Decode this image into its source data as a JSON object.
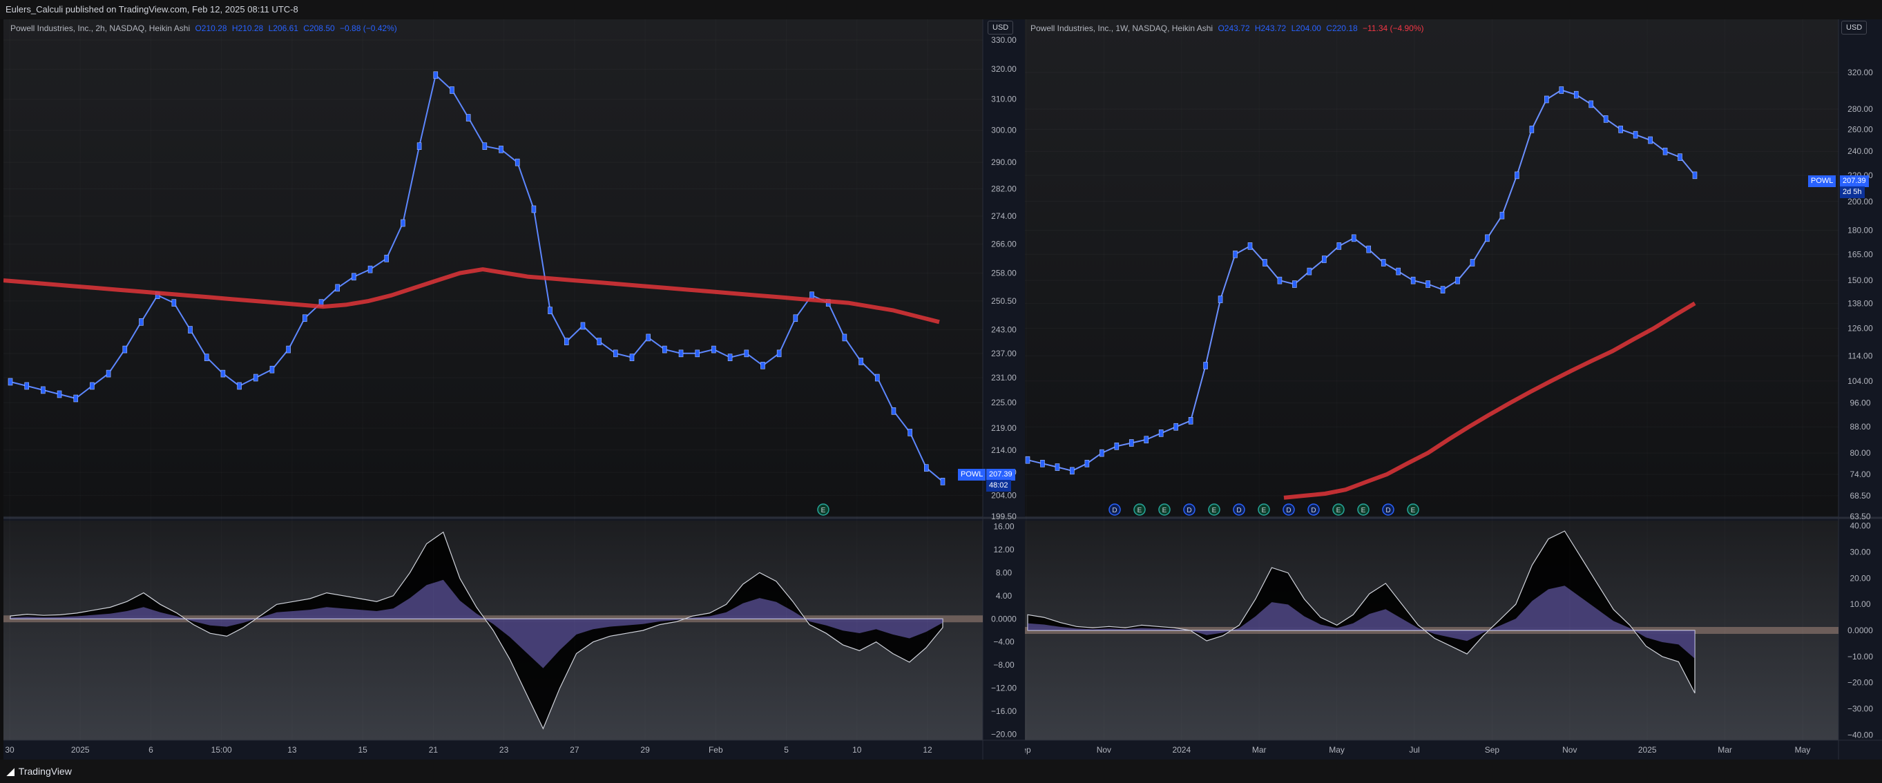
{
  "header": {
    "title": "Eulers_Calculi published on TradingView.com, Feb 12, 2025 08:11 UTC-8"
  },
  "footer": {
    "brand": "TradingView"
  },
  "charts": {
    "left": {
      "legend": {
        "name": "Powell Industries, Inc., 2h, NASDAQ, Heikin Ashi",
        "open": "O210.28",
        "high": "H210.28",
        "low": "L206.61",
        "close": "C208.50",
        "change": "−0.88 (−0.42%)"
      },
      "currency": "USD",
      "price_badge": {
        "ticker": "POWL",
        "price": "207.39",
        "countdown": "48:02"
      },
      "event_markers": [
        "E"
      ]
    },
    "right": {
      "legend": {
        "name": "Powell Industries, Inc., 1W, NASDAQ, Heikin Ashi",
        "open": "O243.72",
        "high": "H243.72",
        "low": "L204.00",
        "close": "C220.18",
        "change": "−11.34 (−4.90%)"
      },
      "currency": "USD",
      "price_badge": {
        "ticker": "POWL",
        "price": "207.39",
        "countdown": "2d 5h"
      },
      "event_markers": [
        "D",
        "E",
        "E",
        "D",
        "E",
        "D",
        "E",
        "D",
        "D",
        "E",
        "E",
        "D",
        "E"
      ]
    }
  },
  "chart_data": [
    {
      "type": "line",
      "title": "Powell Industries, Inc., 2h, NASDAQ, Heikin Ashi",
      "xticks": [
        "30",
        "2025",
        "6",
        "15:00",
        "13",
        "15",
        "21",
        "23",
        "27",
        "29",
        "Feb",
        "5",
        "10",
        "12"
      ],
      "yticks": [
        330,
        320,
        310,
        300,
        290,
        282,
        274,
        266,
        258,
        250.5,
        243,
        237,
        231,
        225,
        219,
        214,
        209,
        204,
        199.5
      ],
      "ylabels": [
        "330.00",
        "320.00",
        "310.00",
        "300.00",
        "290.00",
        "282.00",
        "274.00",
        "266.00",
        "258.00",
        "250.50",
        "243.00",
        "237.00",
        "231.00",
        "225.00",
        "219.00",
        "214.00",
        "209.00",
        "204.00",
        "199.50"
      ],
      "ylim": [
        199.5,
        330
      ],
      "scale": "log",
      "series": [
        {
          "values": [
            230,
            229,
            228,
            227,
            226,
            229,
            232,
            238,
            245,
            252,
            250,
            243,
            236,
            232,
            229,
            231,
            233,
            238,
            246,
            250,
            254,
            257,
            259,
            262,
            272,
            295,
            318,
            313,
            304,
            295,
            294,
            290,
            276,
            248,
            240,
            244,
            240,
            237,
            236,
            241,
            238,
            237,
            237,
            238,
            236,
            237,
            234,
            237,
            246,
            252,
            250,
            241,
            235,
            231,
            223,
            218,
            210,
            207
          ]
        },
        {
          "values": [
            256,
            255.5,
            255,
            254.5,
            254,
            253.5,
            253,
            252.5,
            252,
            251.5,
            251,
            250.5,
            250,
            249.5,
            249,
            249.5,
            250.5,
            252,
            254,
            256,
            258,
            259,
            258,
            257,
            256.5,
            256,
            255.5,
            255,
            254.5,
            254,
            253.5,
            253,
            252.5,
            252,
            251.5,
            251,
            250.5,
            250,
            249,
            248,
            246.5,
            245
          ]
        }
      ],
      "subplot": {
        "yticks": [
          16,
          12,
          8,
          4,
          0,
          -4,
          -8,
          -12,
          -16,
          -20
        ],
        "ylabels": [
          "16.00",
          "12.00",
          "8.00",
          "4.00",
          "0.0000",
          "−4.00",
          "−8.00",
          "−12.00",
          "−16.00",
          "−20.00"
        ],
        "ylim": [
          -21,
          17
        ],
        "series": [
          {
            "values": [
              0.5,
              0.8,
              0.6,
              0.7,
              1.0,
              1.5,
              2.0,
              3.0,
              4.5,
              2.5,
              1.0,
              -1.0,
              -2.5,
              -3.0,
              -1.5,
              0.5,
              2.5,
              3.0,
              3.5,
              4.5,
              4.0,
              3.5,
              3.0,
              4.0,
              8.0,
              13.0,
              15.0,
              7.0,
              2.0,
              -2.0,
              -7.0,
              -13.0,
              -19.0,
              -12.0,
              -6.0,
              -4.0,
              -3.0,
              -2.5,
              -2.0,
              -1.0,
              -0.5,
              0.5,
              1.0,
              2.5,
              6.0,
              8.0,
              6.5,
              3.0,
              -1.0,
              -2.5,
              -4.5,
              -5.5,
              -4.0,
              -6.0,
              -7.5,
              -5.0,
              -1.5
            ]
          }
        ]
      }
    },
    {
      "type": "line",
      "title": "Powell Industries, Inc., 1W, NASDAQ, Heikin Ashi",
      "xticks": [
        "ep",
        "Nov",
        "2024",
        "Mar",
        "May",
        "Jul",
        "Sep",
        "Nov",
        "2025",
        "Mar",
        "May"
      ],
      "yticks": [
        320,
        280,
        260,
        240,
        220,
        200,
        180,
        165,
        150,
        138,
        126,
        114,
        104,
        96,
        88,
        80,
        74,
        68.5,
        63.5
      ],
      "ylabels": [
        "320.00",
        "280.00",
        "260.00",
        "240.00",
        "220.00",
        "200.00",
        "180.00",
        "165.00",
        "150.00",
        "138.00",
        "126.00",
        "114.00",
        "104.00",
        "96.00",
        "88.00",
        "80.00",
        "74.00",
        "68.50",
        "63.50"
      ],
      "ylim": [
        63.5,
        360
      ],
      "scale": "log",
      "series": [
        {
          "values": [
            78,
            77,
            76,
            75,
            77,
            80,
            82,
            83,
            84,
            86,
            88,
            90,
            110,
            140,
            165,
            170,
            160,
            150,
            148,
            155,
            162,
            170,
            175,
            168,
            160,
            155,
            150,
            148,
            145,
            150,
            160,
            175,
            190,
            220,
            260,
            290,
            300,
            295,
            285,
            270,
            260,
            255,
            250,
            240,
            235,
            220
          ]
        },
        {
          "values": [
            68,
            68.5,
            69,
            70,
            72,
            74,
            77,
            80,
            84,
            88,
            92,
            96,
            100,
            104,
            108,
            112,
            116,
            121,
            126,
            132,
            138
          ]
        }
      ],
      "subplot": {
        "yticks": [
          40,
          30,
          20,
          10,
          0,
          -10,
          -20,
          -30,
          -40
        ],
        "ylabels": [
          "40.00",
          "30.00",
          "20.00",
          "10.00",
          "0.0000",
          "−10.00",
          "−20.00",
          "−30.00",
          "−40.00"
        ],
        "ylim": [
          -42,
          42
        ],
        "series": [
          {
            "values": [
              6,
              5,
              3,
              1.5,
              1,
              1.5,
              1,
              2,
              1.5,
              1,
              0,
              -4,
              -2,
              2,
              12,
              24,
              22,
              12,
              5,
              2,
              6,
              14,
              18,
              10,
              2,
              -3,
              -6,
              -9,
              -2,
              4,
              10,
              25,
              35,
              38,
              28,
              18,
              8,
              2,
              -6,
              -10,
              -12,
              -24
            ]
          }
        ]
      }
    }
  ]
}
